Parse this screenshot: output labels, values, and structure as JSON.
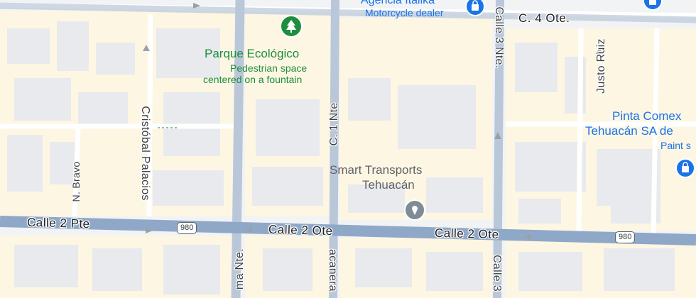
{
  "map": {
    "colors": {
      "background": "#f1f3f4",
      "block": "#fdf6e3",
      "building": "#e8eaed",
      "street": "#ffffff",
      "main_road": "#8fa8c8",
      "park_accent": "#1e8e3e",
      "poi_blue": "#1a73e8"
    },
    "streets": {
      "calle_2_pte": "Calle 2 Pte",
      "calle_2_ote_left": "Calle 2 Ote",
      "calle_2_ote_right": "Calle 2 Ote",
      "c4_ote": "C. 4 Ote.",
      "calle_3_nte": "Calle 3 Nte.",
      "calle_3_bottom": "Calle 3",
      "c1_nte": "C. 1 Nte",
      "cristobal": "Cristóbal Palacios",
      "bravo": "N. Bravo",
      "justo_ruiz": "Justo Ruiz",
      "ma_nte": "ma Nte.",
      "acanera": "acanera"
    },
    "shields": {
      "left": "980",
      "right": "980"
    },
    "pois": {
      "parque": {
        "name": "Parque Ecológico",
        "desc_line1": "Pedestrian space",
        "desc_line2": "centered on a fountain",
        "icon": "tree-icon"
      },
      "agencia": {
        "name": "Agencia Italika",
        "category": "Motorcycle dealer",
        "icon": "shopping-bag-icon"
      },
      "smart": {
        "name_line1": "Smart Transports",
        "name_line2": "Tehuacán",
        "icon": "place-pin-icon"
      },
      "pinta": {
        "name_line1": "Pinta Comex",
        "name_line2": "Tehuacán SA de",
        "category": "Paint s",
        "icon": "shopping-bag-icon"
      }
    }
  }
}
